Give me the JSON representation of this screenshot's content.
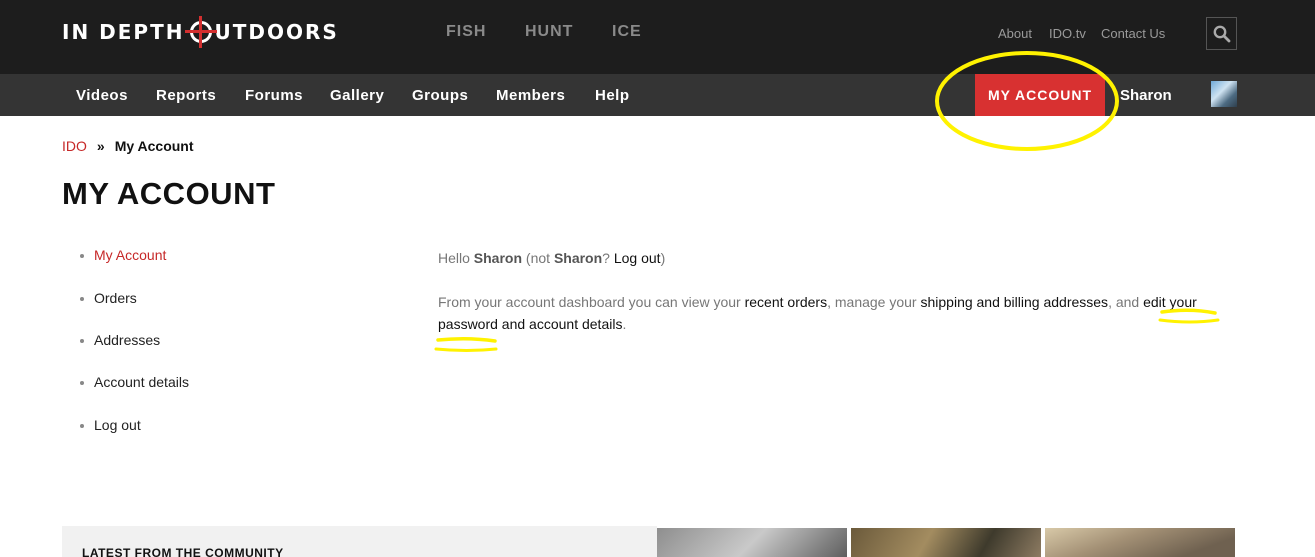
{
  "header": {
    "logo_left": "IN DEPTH",
    "logo_right": "UTDOORS",
    "top_nav": [
      "FISH",
      "HUNT",
      "ICE"
    ],
    "utility_links": [
      "About",
      "IDO.tv",
      "Contact Us"
    ],
    "search_icon": "search-icon"
  },
  "main_nav": {
    "items": [
      "Videos",
      "Reports",
      "Forums",
      "Gallery",
      "Groups",
      "Members",
      "Help"
    ],
    "my_account_label": "MY ACCOUNT",
    "username": "Sharon"
  },
  "breadcrumb": {
    "home": "IDO",
    "separator": "»",
    "current": "My Account"
  },
  "page": {
    "title": "MY ACCOUNT"
  },
  "account_menu": {
    "items": [
      "My Account",
      "Orders",
      "Addresses",
      "Account details",
      "Log out"
    ]
  },
  "dashboard": {
    "hello": "Hello ",
    "user": "Sharon",
    "not_prefix": " (not ",
    "not_user": "Sharon",
    "not_suffix": "? ",
    "logout": "Log out",
    "close_paren": ")",
    "intro": "From your account dashboard you can view your ",
    "recent_orders": "recent orders",
    "comma_manage": ", manage your ",
    "addresses": "shipping and billing addresses",
    "and": ", and ",
    "edit_details": "edit your password and account details",
    "period": "."
  },
  "community": {
    "heading": "LATEST FROM THE COMMUNITY"
  },
  "colors": {
    "accent": "#d83131",
    "link_red": "#c62828",
    "annotation": "#fff200",
    "topbar": "#1d1d1d",
    "navbar": "#343434"
  }
}
